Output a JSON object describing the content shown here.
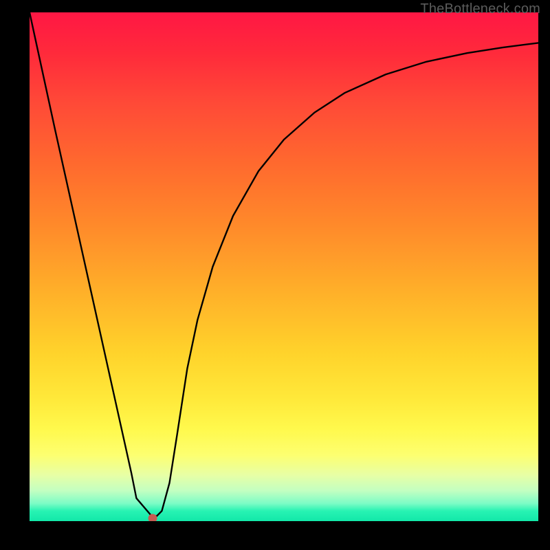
{
  "watermark": "TheBottleneck.com",
  "marker": {
    "x_frac": 0.242,
    "y_frac": 0.995
  },
  "chart_data": {
    "type": "line",
    "title": "",
    "xlabel": "",
    "ylabel": "",
    "xlim": [
      0,
      1
    ],
    "ylim": [
      0,
      1
    ],
    "grid": false,
    "background_gradient": [
      {
        "stop": 0.0,
        "color": "#ff1744"
      },
      {
        "stop": 0.5,
        "color": "#ffb029"
      },
      {
        "stop": 0.82,
        "color": "#fff94d"
      },
      {
        "stop": 1.0,
        "color": "#12e8a9"
      }
    ],
    "series": [
      {
        "name": "curve",
        "x": [
          0.0,
          0.05,
          0.1,
          0.15,
          0.2,
          0.21,
          0.24,
          0.25,
          0.26,
          0.275,
          0.29,
          0.31,
          0.33,
          0.36,
          0.4,
          0.45,
          0.5,
          0.56,
          0.62,
          0.7,
          0.78,
          0.86,
          0.93,
          1.0
        ],
        "y": [
          1.0,
          0.77,
          0.545,
          0.32,
          0.095,
          0.045,
          0.01,
          0.01,
          0.02,
          0.075,
          0.17,
          0.3,
          0.395,
          0.5,
          0.6,
          0.688,
          0.75,
          0.803,
          0.842,
          0.878,
          0.903,
          0.92,
          0.931,
          0.94
        ]
      }
    ],
    "marker_point": {
      "x": 0.242,
      "y": 0.005,
      "color": "#c65c52"
    }
  }
}
